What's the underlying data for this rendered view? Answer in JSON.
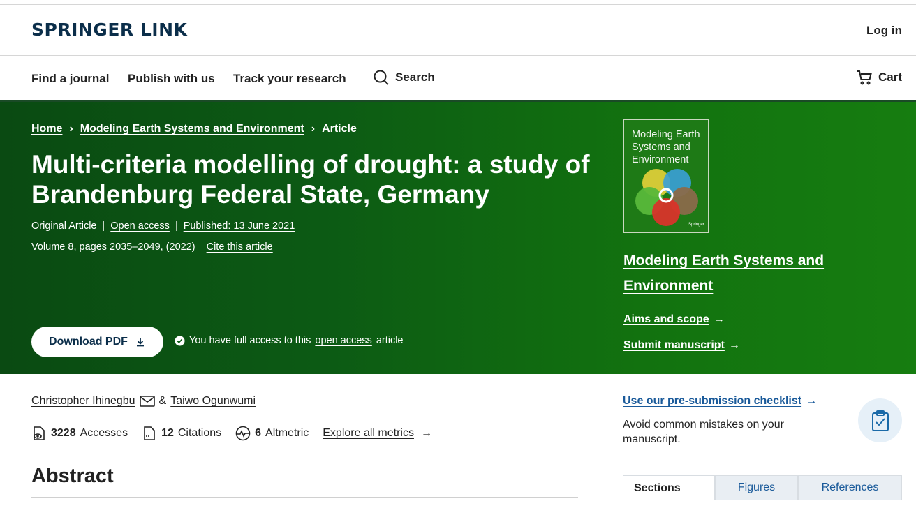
{
  "header": {
    "logo": "SPRINGER LINK",
    "login": "Log in"
  },
  "nav": {
    "items": [
      "Find a journal",
      "Publish with us",
      "Track your research"
    ],
    "search": "Search",
    "cart": "Cart"
  },
  "breadcrumb": {
    "home": "Home",
    "journal": "Modeling Earth Systems and Environment",
    "current": "Article"
  },
  "article": {
    "title": "Multi-criteria modelling of drought: a study of Brandenburg Federal State, Germany",
    "type": "Original Article",
    "access": "Open access",
    "published": "Published: 13 June 2021",
    "volume": "Volume 8, pages 2035–2049, (2022)",
    "cite": "Cite this article",
    "download": "Download PDF",
    "access_prefix": "You have full access to this",
    "access_link": "open access",
    "access_suffix": "article"
  },
  "journal": {
    "cover_title": "Modeling Earth Systems and Environment",
    "name": "Modeling Earth Systems and Environment",
    "aims": "Aims and scope",
    "submit": "Submit manuscript"
  },
  "authors": {
    "first": "Christopher Ihinegbu",
    "amp": "&",
    "second": "Taiwo Ogunwumi"
  },
  "metrics": {
    "accesses_value": "3228",
    "accesses_label": "Accesses",
    "citations_value": "12",
    "citations_label": "Citations",
    "altmetric_value": "6",
    "altmetric_label": "Altmetric",
    "explore": "Explore all metrics"
  },
  "abstract": {
    "heading": "Abstract"
  },
  "sidebar": {
    "checklist_link": "Use our pre-submission checklist",
    "checklist_desc": "Avoid common mistakes on your manuscript.",
    "tabs": [
      "Sections",
      "Figures",
      "References"
    ]
  }
}
